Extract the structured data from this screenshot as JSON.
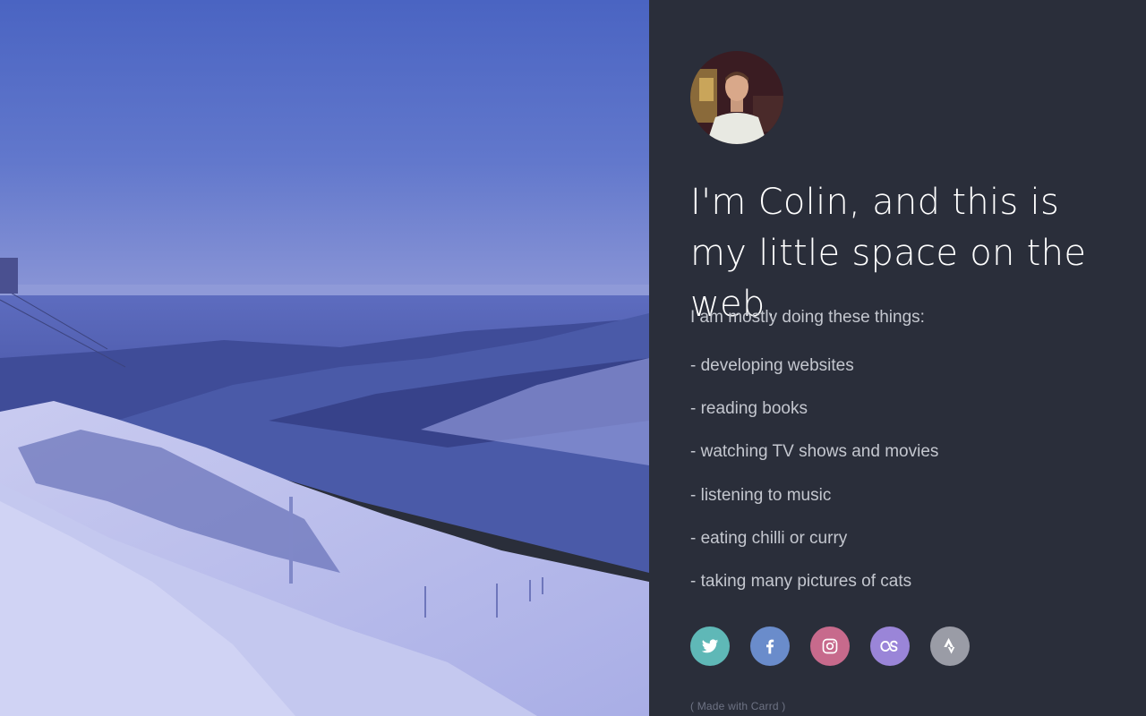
{
  "profile": {
    "photo_icon": "person-portrait",
    "headline": "I'm Colin, and this is my little space on the web.",
    "intro": "I am mostly doing these things:",
    "activities": [
      "- developing websites",
      "- reading books",
      "- watching TV shows and movies",
      "- listening to music",
      "- eating chilli or curry",
      "- taking many pictures of cats"
    ]
  },
  "social": [
    {
      "name": "twitter-icon",
      "color": "#5fb8b7"
    },
    {
      "name": "facebook-icon",
      "color": "#6a8ccb"
    },
    {
      "name": "instagram-icon",
      "color": "#c76a8c"
    },
    {
      "name": "lastfm-icon",
      "color": "#9a85d8"
    },
    {
      "name": "strava-icon",
      "color": "#9a9ca6"
    }
  ],
  "footer": {
    "credit": "( Made with Carrd )"
  },
  "colors": {
    "panel_background": "#2a2e3a",
    "photo_tint": "#5a6ad0"
  }
}
